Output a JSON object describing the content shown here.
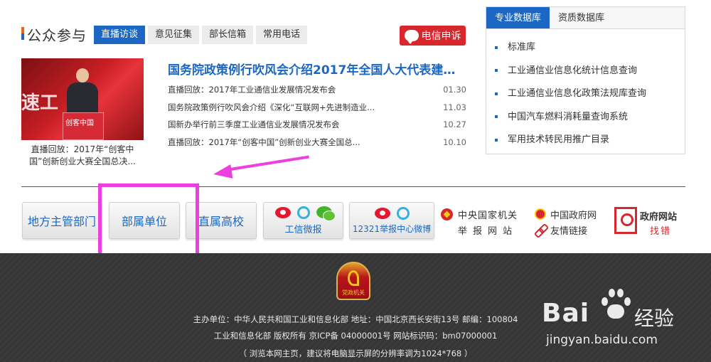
{
  "public_participation": {
    "title": "公众参与",
    "tabs": [
      "直播访谈",
      "意见征集",
      "部长信箱",
      "常用电话"
    ],
    "active_tab": 0,
    "email_button": "电信申诉",
    "feature_image_text": "速工",
    "feature_image_podium": "创客中国",
    "feature_caption": "直播回放：2017年“创客中国”创新创业大赛全国总决...",
    "headline": "国务院政策例行吹风会介绍2017年全国人大代表建议...",
    "news": [
      {
        "title": "直播回放：2017年工业通信业发展情况发布会",
        "date": "01.30"
      },
      {
        "title": "国务院政策例行吹风会介绍《深化“互联网+先进制造业...",
        "date": "11.03"
      },
      {
        "title": "国新办举行前三季度工业通信业发展情况发布会",
        "date": "10.27"
      },
      {
        "title": "直播回放：2017年“创客中国”创新创业大赛全国总...",
        "date": "10.10"
      }
    ]
  },
  "database_panel": {
    "tabs": [
      "专业数据库",
      "资质数据库"
    ],
    "active_tab": 0,
    "items": [
      "标准库",
      "工业通信业信息化统计信息查询",
      "工业通信业信息化政策法规库查询",
      "中国汽车燃料消耗量查询系统",
      "军用技术转民用推广目录"
    ]
  },
  "quick_links": {
    "local": "地方主管部门",
    "affiliated": "部属单位",
    "universities": "直属高校",
    "miit_weibo": "工信微报",
    "report_weibo": "12321举报中心微博",
    "central_line1": "中央国家机关",
    "central_line2": "举报网站",
    "gov_site": "中国政府网",
    "friend_links": "友情链接",
    "error_line1": "政府网站",
    "error_line2": "找错"
  },
  "footer": {
    "badge_label": "党政机关",
    "line1": "主办单位：中华人民共和国工业和信息化部 地址：中国北京西长安街13号 邮编：100804",
    "line2": "工业和信息化部 版权所有 京ICP备 04000001号  网站标识码：bm07000001",
    "line3": "（ 浏览本网主页，建议将电脑显示屏的分辨率调为1024*768 ）"
  },
  "watermark": {
    "brand": "Bai",
    "product": "经验",
    "url": "jingyan.baidu.com"
  },
  "colors": {
    "brand_blue": "#1b67c3",
    "alert_red": "#d6282c",
    "annotation_magenta": "#ee3ee0",
    "footer_bg": "#383838"
  }
}
